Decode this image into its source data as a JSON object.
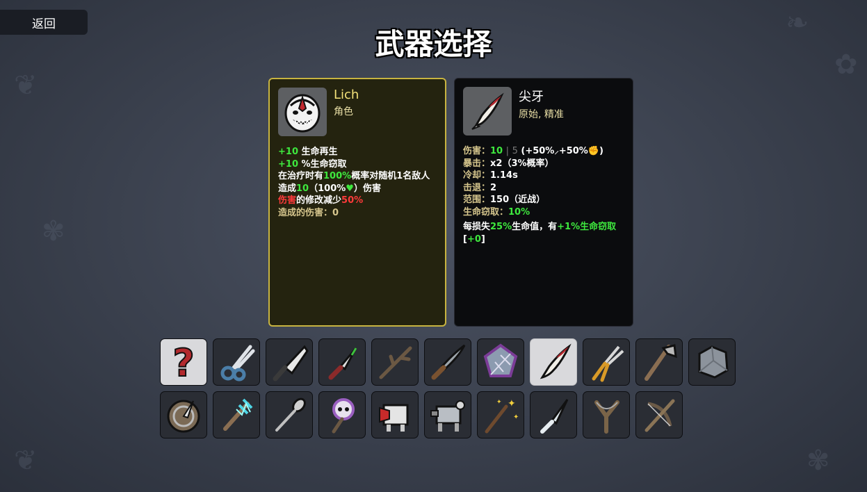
{
  "header": {
    "back_label": "返回",
    "title": "武器选择"
  },
  "character": {
    "name": "Lich",
    "type": "角色",
    "icon": "lich-mask-icon",
    "stat1_value": "+10",
    "stat1_label": "生命再生",
    "stat2_value": "+10",
    "stat2_label": "%生命窃取",
    "heal_a": "在治疗时有",
    "heal_chance": "100%",
    "heal_b": "概率对随机1名敌人造成",
    "heal_dmg": "10",
    "heal_c": "（100%",
    "heal_heart": "♥",
    "heal_d": "）伤害",
    "dmg_word": "伤害",
    "dmg_mid": "的修改减少",
    "dmg_pct": "50%",
    "dealt_label": "造成的伤害：",
    "dealt_value": "0"
  },
  "weapon": {
    "name": "尖牙",
    "tags": "原始, 精准",
    "icon": "fang-icon",
    "damage_label": "伤害：",
    "damage_value": "10",
    "damage_sep": "|",
    "damage_base": "5",
    "damage_scaling": "(+50%",
    "damage_scaling2": "+50%",
    "damage_end": ")",
    "crit_label": "暴击：",
    "crit_value": "x2（3%概率）",
    "cooldown_label": "冷却：",
    "cooldown_value": "1.14s",
    "knockback_label": "击退：",
    "knockback_value": "2",
    "range_label": "范围：",
    "range_value": "150（近战）",
    "lifesteal_label": "生命窃取：",
    "lifesteal_value": "10%",
    "special_a": "每损失",
    "special_pct": "25%",
    "special_b": "生命值，有",
    "special_bonus": "+1%生命窃取",
    "special_bracket_open": "[",
    "special_current": "+0",
    "special_bracket_close": "]"
  },
  "weapon_grid": {
    "row1": [
      {
        "icon": "random-question-icon",
        "selected": false
      },
      {
        "icon": "scissors-icon",
        "selected": false
      },
      {
        "icon": "cleaver-icon",
        "selected": false
      },
      {
        "icon": "knife-icon",
        "selected": false
      },
      {
        "icon": "stick-icon",
        "selected": false
      },
      {
        "icon": "machete-icon",
        "selected": false
      },
      {
        "icon": "spiky-shield-icon",
        "selected": false
      },
      {
        "icon": "fang-icon",
        "selected": true
      },
      {
        "icon": "pruner-icon",
        "selected": false
      },
      {
        "icon": "hatchet-icon",
        "selected": false
      },
      {
        "icon": "rock-icon",
        "selected": false
      }
    ],
    "row2": [
      {
        "icon": "spiked-buckler-icon",
        "selected": false
      },
      {
        "icon": "taser-icon",
        "selected": false
      },
      {
        "icon": "spoon-icon",
        "selected": false
      },
      {
        "icon": "skull-wand-icon",
        "selected": false
      },
      {
        "icon": "megaphone-turret-icon",
        "selected": false
      },
      {
        "icon": "turret-icon",
        "selected": false
      },
      {
        "icon": "magic-wand-icon",
        "selected": false
      },
      {
        "icon": "shiv-icon",
        "selected": false
      },
      {
        "icon": "slingshot-icon",
        "selected": false
      },
      {
        "icon": "crossbow-icon",
        "selected": false
      }
    ]
  },
  "colors": {
    "selected_border": "#c8b440",
    "positive": "#3ee83e",
    "negative": "#ff3a3a",
    "tag": "#e9dfa6"
  }
}
